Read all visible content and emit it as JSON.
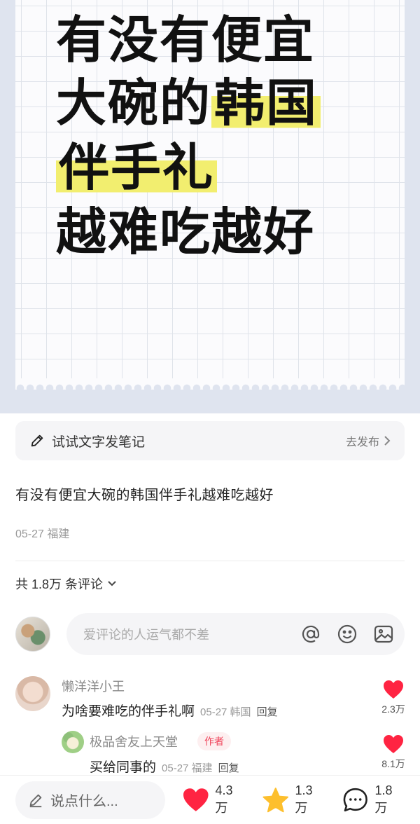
{
  "cover": {
    "line1": "有没有便宜",
    "line2_plain": "大碗的",
    "line2_highlight": "韩国",
    "line3_highlight": "伴手礼",
    "line4": "越难吃越好"
  },
  "try_bar": {
    "label": "试试文字发笔记",
    "action": "去发布"
  },
  "post": {
    "title": "有没有便宜大碗的韩国伴手礼越难吃越好",
    "meta": "05-27 福建"
  },
  "comments_header": {
    "count_label": "共 1.8万 条评论"
  },
  "composer": {
    "placeholder": "爱评论的人运气都不差"
  },
  "comments": [
    {
      "name": "懒洋洋小王",
      "text": "为啥要难吃的伴手礼啊",
      "meta": "05-27 韩国",
      "reply": "回复",
      "likes": "2.3万"
    },
    {
      "name": "极品舍友上天堂",
      "tag": "作者",
      "text": "买给同事的",
      "meta": "05-27 福建",
      "reply": "回复",
      "likes": "8.1万"
    }
  ],
  "bottom_bar": {
    "say_placeholder": "说点什么...",
    "likes": "4.3万",
    "stars": "1.3万",
    "comments": "1.8万"
  },
  "colors": {
    "accent_red": "#ff2442",
    "star_yellow": "#fdbf2d",
    "highlight": "#f2ee6f"
  }
}
